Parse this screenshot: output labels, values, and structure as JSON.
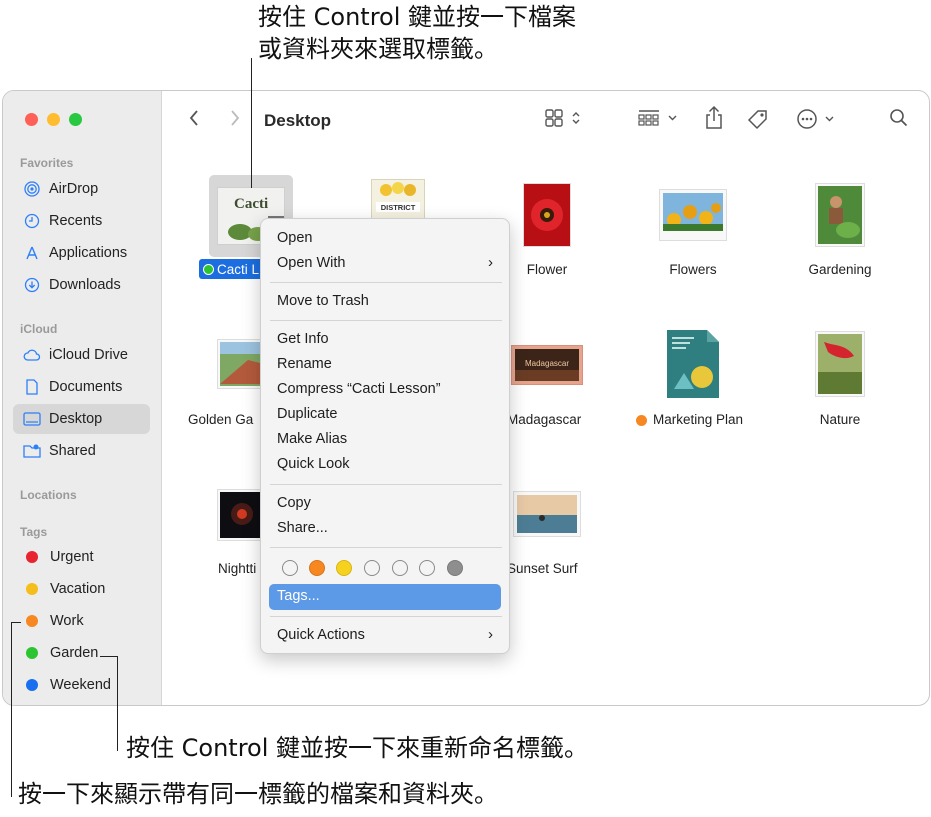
{
  "callouts": {
    "top_line1": "按住 Control 鍵並按一下檔案",
    "top_line2": "或資料夾來選取標籤。",
    "bottom1": "按住 Control 鍵並按一下來重新命名標籤。",
    "bottom2": "按一下來顯示帶有同一標籤的檔案和資料夾。"
  },
  "window": {
    "title": "Desktop"
  },
  "sidebar": {
    "favorites_header": "Favorites",
    "favorites": [
      {
        "label": "AirDrop",
        "icon": "airdrop-icon"
      },
      {
        "label": "Recents",
        "icon": "clock-icon"
      },
      {
        "label": "Applications",
        "icon": "applications-icon"
      },
      {
        "label": "Downloads",
        "icon": "download-icon"
      }
    ],
    "icloud_header": "iCloud",
    "icloud": [
      {
        "label": "iCloud Drive",
        "icon": "cloud-icon"
      },
      {
        "label": "Documents",
        "icon": "document-icon"
      },
      {
        "label": "Desktop",
        "icon": "desktop-icon",
        "selected": true
      },
      {
        "label": "Shared",
        "icon": "shared-folder-icon"
      }
    ],
    "locations_header": "Locations",
    "tags_header": "Tags",
    "tags": [
      {
        "label": "Urgent",
        "color": "#e8242f"
      },
      {
        "label": "Vacation",
        "color": "#f6be1a"
      },
      {
        "label": "Work",
        "color": "#f78821"
      },
      {
        "label": "Garden",
        "color": "#2cc431"
      },
      {
        "label": "Weekend",
        "color": "#1a6ff0"
      }
    ]
  },
  "files": [
    {
      "name": "Cacti L",
      "selected": true,
      "tag_color": "#2cc431",
      "thumb_text": "Cacti"
    },
    {
      "name": "",
      "thumb_text": "DISTRICT"
    },
    {
      "name": "Flower"
    },
    {
      "name": "Flowers"
    },
    {
      "name": "Gardening"
    },
    {
      "name": "Golden Ga"
    },
    {
      "name": "Madagascar",
      "thumb_text": "Madagascar"
    },
    {
      "name": "Marketing Plan",
      "tag_color": "#f78821"
    },
    {
      "name": "Nature"
    },
    {
      "name": "Nightti"
    },
    {
      "name": "Sunset Surf"
    }
  ],
  "context_menu": {
    "open": "Open",
    "open_with": "Open With",
    "move_to_trash": "Move to Trash",
    "get_info": "Get Info",
    "rename": "Rename",
    "compress": "Compress “Cacti Lesson”",
    "duplicate": "Duplicate",
    "make_alias": "Make Alias",
    "quick_look": "Quick Look",
    "copy": "Copy",
    "share": "Share...",
    "tags": "Tags...",
    "quick_actions": "Quick Actions",
    "tag_colors": [
      "none",
      "#f78821",
      "#f6d21f",
      "none",
      "none",
      "none",
      "#8e8e8e"
    ]
  }
}
